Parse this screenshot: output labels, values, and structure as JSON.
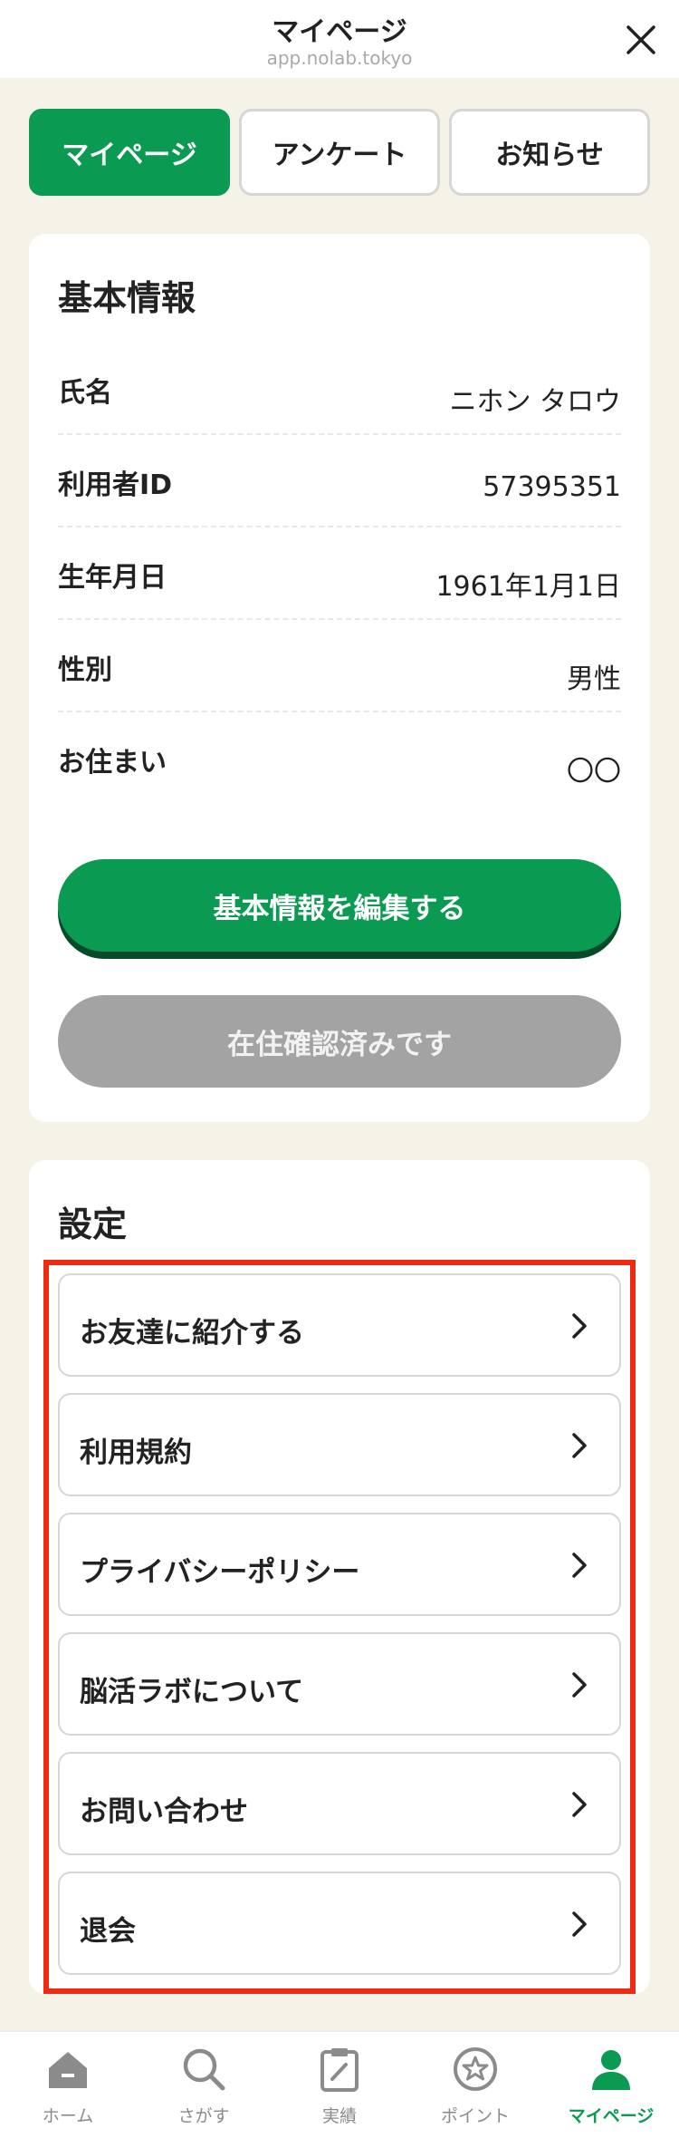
{
  "header": {
    "title": "マイページ",
    "url": "app.nolab.tokyo"
  },
  "tabs": [
    {
      "label": "マイページ",
      "active": true
    },
    {
      "label": "アンケート",
      "active": false
    },
    {
      "label": "お知らせ",
      "active": false
    }
  ],
  "basic_info": {
    "title": "基本情報",
    "rows": [
      {
        "label": "氏名",
        "value": "ニホン タロウ"
      },
      {
        "label": "利用者ID",
        "value": "57395351"
      },
      {
        "label": "生年月日",
        "value": "1961年1月1日"
      },
      {
        "label": "性別",
        "value": "男性"
      },
      {
        "label": "お住まい",
        "value": "〇〇"
      }
    ],
    "edit_button": "基本情報を編集する",
    "residence_button": "在住確認済みです"
  },
  "settings": {
    "title": "設定",
    "items": [
      {
        "label": "お友達に紹介する"
      },
      {
        "label": "利用規約"
      },
      {
        "label": "プライバシーポリシー"
      },
      {
        "label": "脳活ラボについて"
      },
      {
        "label": "お問い合わせ"
      },
      {
        "label": "退会"
      }
    ]
  },
  "bottom_nav": [
    {
      "label": "ホーム",
      "icon": "home-icon",
      "active": false
    },
    {
      "label": "さがす",
      "icon": "search-icon",
      "active": false
    },
    {
      "label": "実績",
      "icon": "clipboard-icon",
      "active": false
    },
    {
      "label": "ポイント",
      "icon": "star-icon",
      "active": false
    },
    {
      "label": "マイページ",
      "icon": "user-icon",
      "active": true
    }
  ],
  "colors": {
    "accent": "#0a9a52",
    "highlight_border": "#f02a10",
    "background": "#f5f2e8",
    "disabled_button": "#a3a3a3"
  }
}
